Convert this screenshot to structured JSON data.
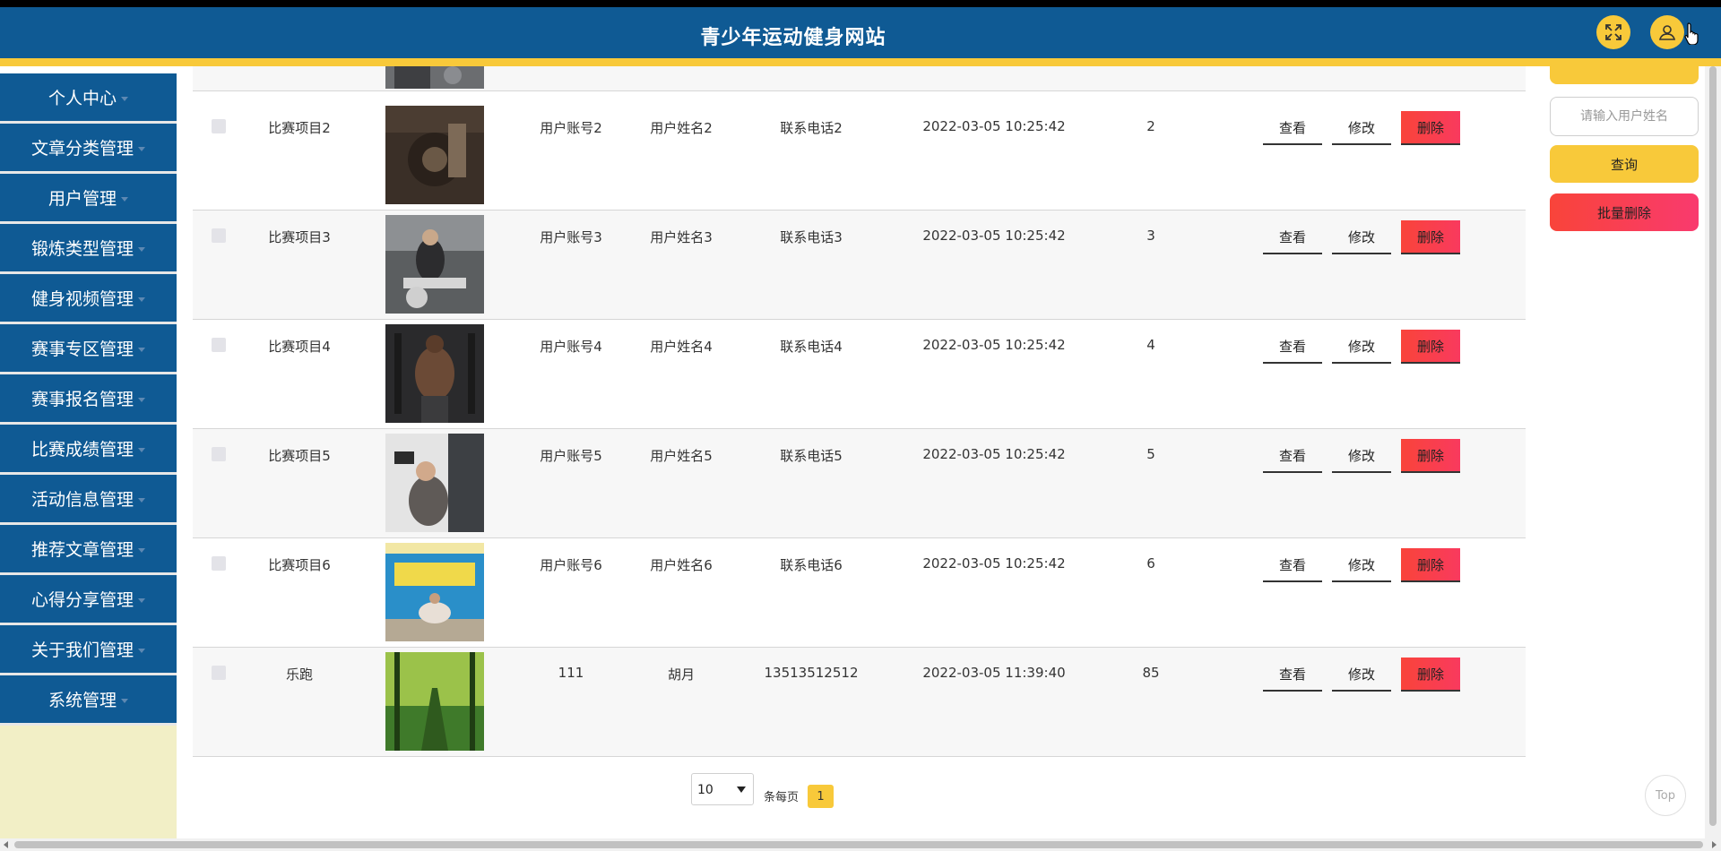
{
  "header": {
    "title": "青少年运动健身网站",
    "fullscreen_icon": "expand-icon",
    "user_icon": "user-icon",
    "accent": "#f8c93a",
    "brand": "#0f5a94"
  },
  "sidebar": {
    "items": [
      {
        "label": "个人中心"
      },
      {
        "label": "文章分类管理"
      },
      {
        "label": "用户管理"
      },
      {
        "label": "锻炼类型管理"
      },
      {
        "label": "健身视频管理"
      },
      {
        "label": "赛事专区管理"
      },
      {
        "label": "赛事报名管理"
      },
      {
        "label": "比赛成绩管理"
      },
      {
        "label": "活动信息管理"
      },
      {
        "label": "推荐文章管理"
      },
      {
        "label": "心得分享管理"
      },
      {
        "label": "关于我们管理"
      },
      {
        "label": "系统管理"
      }
    ]
  },
  "table": {
    "actions": {
      "view": "查看",
      "edit": "修改",
      "delete": "删除"
    },
    "rows": [
      {
        "project": "比赛项目2",
        "account": "用户账号2",
        "name": "用户姓名2",
        "phone": "联系电话2",
        "time": "2022-03-05 10:25:42",
        "score": "2"
      },
      {
        "project": "比赛项目3",
        "account": "用户账号3",
        "name": "用户姓名3",
        "phone": "联系电话3",
        "time": "2022-03-05 10:25:42",
        "score": "3"
      },
      {
        "project": "比赛项目4",
        "account": "用户账号4",
        "name": "用户姓名4",
        "phone": "联系电话4",
        "time": "2022-03-05 10:25:42",
        "score": "4"
      },
      {
        "project": "比赛项目5",
        "account": "用户账号5",
        "name": "用户姓名5",
        "phone": "联系电话5",
        "time": "2022-03-05 10:25:42",
        "score": "5"
      },
      {
        "project": "比赛项目6",
        "account": "用户账号6",
        "name": "用户姓名6",
        "phone": "联系电话6",
        "time": "2022-03-05 10:25:42",
        "score": "6"
      },
      {
        "project": "乐跑",
        "account": "111",
        "name": "胡月",
        "phone": "13513512512",
        "time": "2022-03-05 11:39:40",
        "score": "85"
      }
    ]
  },
  "search_panel": {
    "name_placeholder": "请输入用户姓名",
    "query_label": "查询",
    "batch_delete_label": "批量删除"
  },
  "pagination": {
    "page_size": "10",
    "per_page_label": "条每页",
    "current_page": "1"
  },
  "back_to_top": "Top"
}
